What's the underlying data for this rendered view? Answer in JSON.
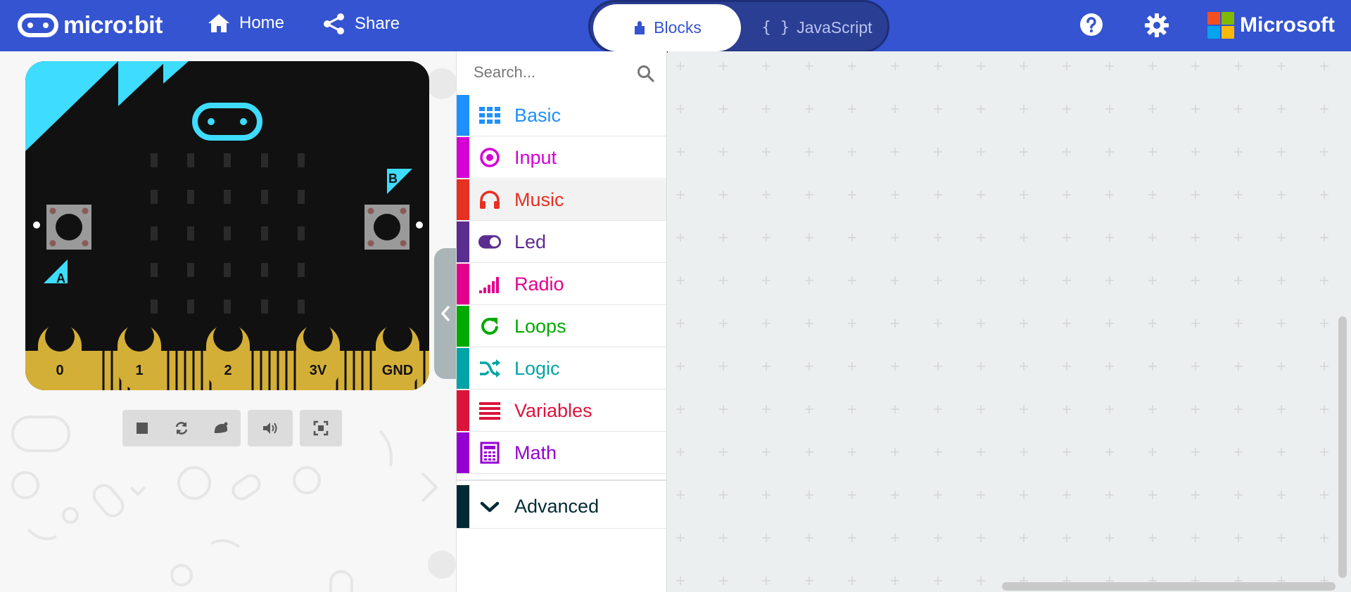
{
  "header": {
    "logo_text": "micro:bit",
    "nav": [
      {
        "label": "Home",
        "icon": "home-icon"
      },
      {
        "label": "Share",
        "icon": "share-icon"
      }
    ],
    "editor_toggle": {
      "blocks_label": "Blocks",
      "javascript_label": "JavaScript",
      "javascript_glyph": "{ }",
      "active": "Blocks"
    },
    "help_icon": "help-icon",
    "settings_icon": "gear-icon",
    "brand": "Microsoft"
  },
  "simulator": {
    "pins": [
      "0",
      "1",
      "2",
      "3V",
      "GND"
    ],
    "button_a": "A",
    "button_b": "B",
    "controls": [
      "stop-icon",
      "restart-icon",
      "slow-motion-icon",
      "mute-icon",
      "fullscreen-icon"
    ]
  },
  "toolbox": {
    "search_placeholder": "Search...",
    "categories": [
      {
        "label": "Basic",
        "color": "#1E90FF",
        "icon": "grid-icon"
      },
      {
        "label": "Input",
        "color": "#D400D4",
        "icon": "radio-target-icon"
      },
      {
        "label": "Music",
        "color": "#E63022",
        "icon": "headphones-icon"
      },
      {
        "label": "Led",
        "color": "#5C2D91",
        "icon": "toggle-icon"
      },
      {
        "label": "Radio",
        "color": "#E3008C",
        "icon": "signal-bars-icon"
      },
      {
        "label": "Loops",
        "color": "#00AA00",
        "icon": "refresh-icon"
      },
      {
        "label": "Logic",
        "color": "#00A4A6",
        "icon": "shuffle-icon"
      },
      {
        "label": "Variables",
        "color": "#DC143C",
        "icon": "lines-icon"
      },
      {
        "label": "Math",
        "color": "#9400D3",
        "icon": "calculator-icon"
      }
    ],
    "advanced": {
      "label": "Advanced",
      "color": "#012A34",
      "icon": "chevron-down-icon"
    },
    "active_category": "Music"
  },
  "colors": {
    "header": "#3454D1",
    "board_cyan": "#3EDCFF",
    "pin_gold": "#D4AF37"
  }
}
